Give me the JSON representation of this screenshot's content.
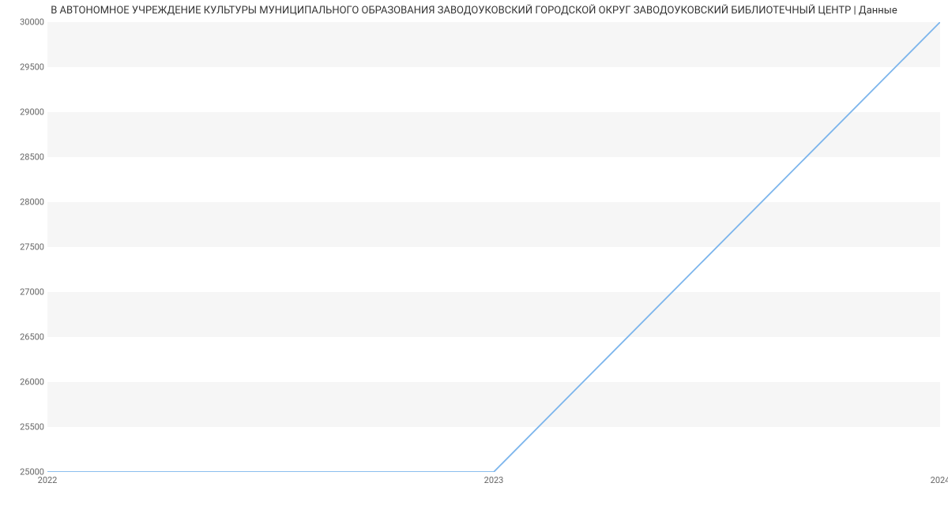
{
  "chart_data": {
    "type": "line",
    "title": "В АВТОНОМНОЕ УЧРЕЖДЕНИЕ КУЛЬТУРЫ МУНИЦИПАЛЬНОГО ОБРАЗОВАНИЯ ЗАВОДОУКОВСКИЙ ГОРОДСКОЙ ОКРУГ ЗАВОДОУКОВСКИЙ БИБЛИОТЕЧНЫЙ ЦЕНТР | Данные",
    "x": [
      2022,
      2023,
      2024
    ],
    "values": [
      25000,
      25000,
      30000
    ],
    "x_ticks": [
      2022,
      2023,
      2024
    ],
    "y_ticks": [
      25000,
      25500,
      26000,
      26500,
      27000,
      27500,
      28000,
      28500,
      29000,
      29500,
      30000
    ],
    "xlim": [
      2022,
      2024
    ],
    "ylim": [
      25000,
      30000
    ],
    "line_color": "#7cb5ec",
    "grid_band_color": "#f6f6f6",
    "axis_color": "#cfd6e3"
  }
}
